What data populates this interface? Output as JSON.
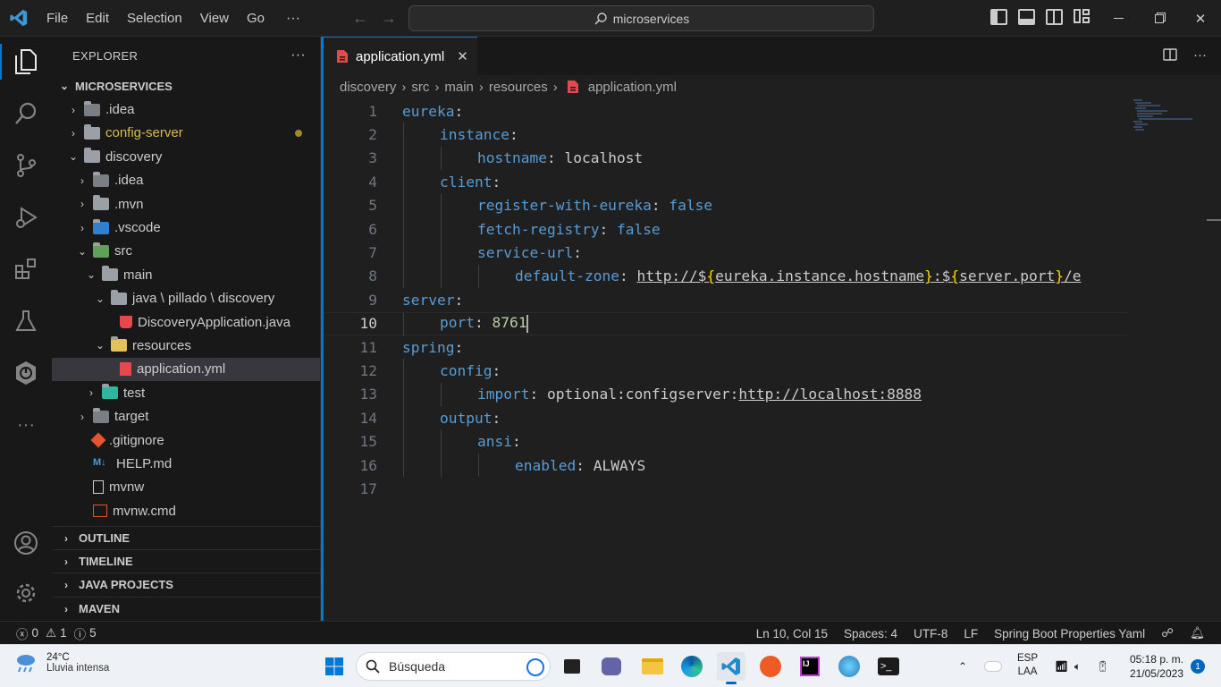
{
  "titlebar": {
    "menu": [
      "File",
      "Edit",
      "Selection",
      "View",
      "Go"
    ],
    "more": "···",
    "search_text": "microservices",
    "back_arrow": "←",
    "forward_arrow": "→"
  },
  "sidebar": {
    "title": "EXPLORER",
    "more": "···",
    "root": "MICROSERVICES",
    "items": [
      {
        "label": ".idea",
        "depth": 1,
        "chevron": "›",
        "icon": "idea-folder-icon"
      },
      {
        "label": "config-server",
        "depth": 1,
        "chevron": "›",
        "icon": "folder-icon",
        "modified": true
      },
      {
        "label": "discovery",
        "depth": 1,
        "chevron": "⌄",
        "icon": "folder-open-icon"
      },
      {
        "label": ".idea",
        "depth": 2,
        "chevron": "›",
        "icon": "idea-folder-icon"
      },
      {
        "label": ".mvn",
        "depth": 2,
        "chevron": "›",
        "icon": "folder-icon"
      },
      {
        "label": ".vscode",
        "depth": 2,
        "chevron": "›",
        "icon": "vscode-folder-icon"
      },
      {
        "label": "src",
        "depth": 2,
        "chevron": "⌄",
        "icon": "src-folder-icon"
      },
      {
        "label": "main",
        "depth": 3,
        "chevron": "⌄",
        "icon": "folder-open-icon"
      },
      {
        "label": "java \\ pillado \\ discovery",
        "depth": 4,
        "chevron": "⌄",
        "icon": "folder-open-icon"
      },
      {
        "label": "DiscoveryApplication.java",
        "depth": 5,
        "chevron": "",
        "icon": "java-file-icon"
      },
      {
        "label": "resources",
        "depth": 4,
        "chevron": "⌄",
        "icon": "resources-folder-icon"
      },
      {
        "label": "application.yml",
        "depth": 5,
        "chevron": "",
        "icon": "yaml-file-icon",
        "selected": true
      },
      {
        "label": "test",
        "depth": 3,
        "chevron": "›",
        "icon": "test-folder-icon"
      },
      {
        "label": "target",
        "depth": 2,
        "chevron": "›",
        "icon": "target-folder-icon"
      },
      {
        "label": ".gitignore",
        "depth": 2,
        "chevron": "",
        "icon": "git-icon"
      },
      {
        "label": "HELP.md",
        "depth": 2,
        "chevron": "",
        "icon": "markdown-icon"
      },
      {
        "label": "mvnw",
        "depth": 2,
        "chevron": "",
        "icon": "file-icon"
      },
      {
        "label": "mvnw.cmd",
        "depth": 2,
        "chevron": "",
        "icon": "terminal-file-icon"
      }
    ],
    "sections": [
      "OUTLINE",
      "TIMELINE",
      "JAVA PROJECTS",
      "MAVEN"
    ]
  },
  "editor": {
    "tab_label": "application.yml",
    "tab_close": "✕",
    "breadcrumb": [
      "discovery",
      "src",
      "main",
      "resources",
      "application.yml"
    ],
    "current_line": 10,
    "lines": [
      {
        "n": "1"
      },
      {
        "n": "2"
      },
      {
        "n": "3"
      },
      {
        "n": "4"
      },
      {
        "n": "5"
      },
      {
        "n": "6"
      },
      {
        "n": "7"
      },
      {
        "n": "8"
      },
      {
        "n": "9"
      },
      {
        "n": "10"
      },
      {
        "n": "11"
      },
      {
        "n": "12"
      },
      {
        "n": "13"
      },
      {
        "n": "14"
      },
      {
        "n": "15"
      },
      {
        "n": "16"
      },
      {
        "n": "17"
      }
    ],
    "code": {
      "l1_key": "eureka",
      "l2_key": "instance",
      "l3_key": "hostname",
      "l3_val": "localhost",
      "l4_key": "client",
      "l5_key": "register-with-eureka",
      "l5_val": "false",
      "l6_key": "fetch-registry",
      "l6_val": "false",
      "l7_key": "service-url",
      "l8_key": "default-zone",
      "l8_a": "http://$",
      "l8_b": "{",
      "l8_c": "eureka.instance.hostname",
      "l8_d": "}",
      "l8_e": ":$",
      "l8_f": "{",
      "l8_g": "server.port",
      "l8_h": "}",
      "l8_i": "/e",
      "l9_key": "server",
      "l10_key": "port",
      "l10_val": "8761",
      "l11_key": "spring",
      "l12_key": "config",
      "l13_key": "import",
      "l13_a": "optional:configserver:",
      "l13_b": "http://localhost:8888",
      "l14_key": "output",
      "l15_key": "ansi",
      "l16_key": "enabled",
      "l16_val": "ALWAYS"
    }
  },
  "statusbar": {
    "errors": "0",
    "warnings": "1",
    "infos": "5",
    "position": "Ln 10, Col 15",
    "spaces": "Spaces: 4",
    "encoding": "UTF-8",
    "eol": "LF",
    "language": "Spring Boot Properties Yaml"
  },
  "taskbar": {
    "temp": "24°C",
    "weather": "Lluvia intensa",
    "search": "Búsqueda",
    "lang_top": "ESP",
    "lang_bottom": "LAA",
    "time": "05:18 p. m.",
    "date": "21/05/2023",
    "notif_count": "1"
  },
  "colors": {
    "accent": "#0078d4",
    "yaml_key": "#569cd6",
    "number": "#b5cea8",
    "bracket": "#ffd700",
    "modified_dot": "#9e8a2b"
  }
}
